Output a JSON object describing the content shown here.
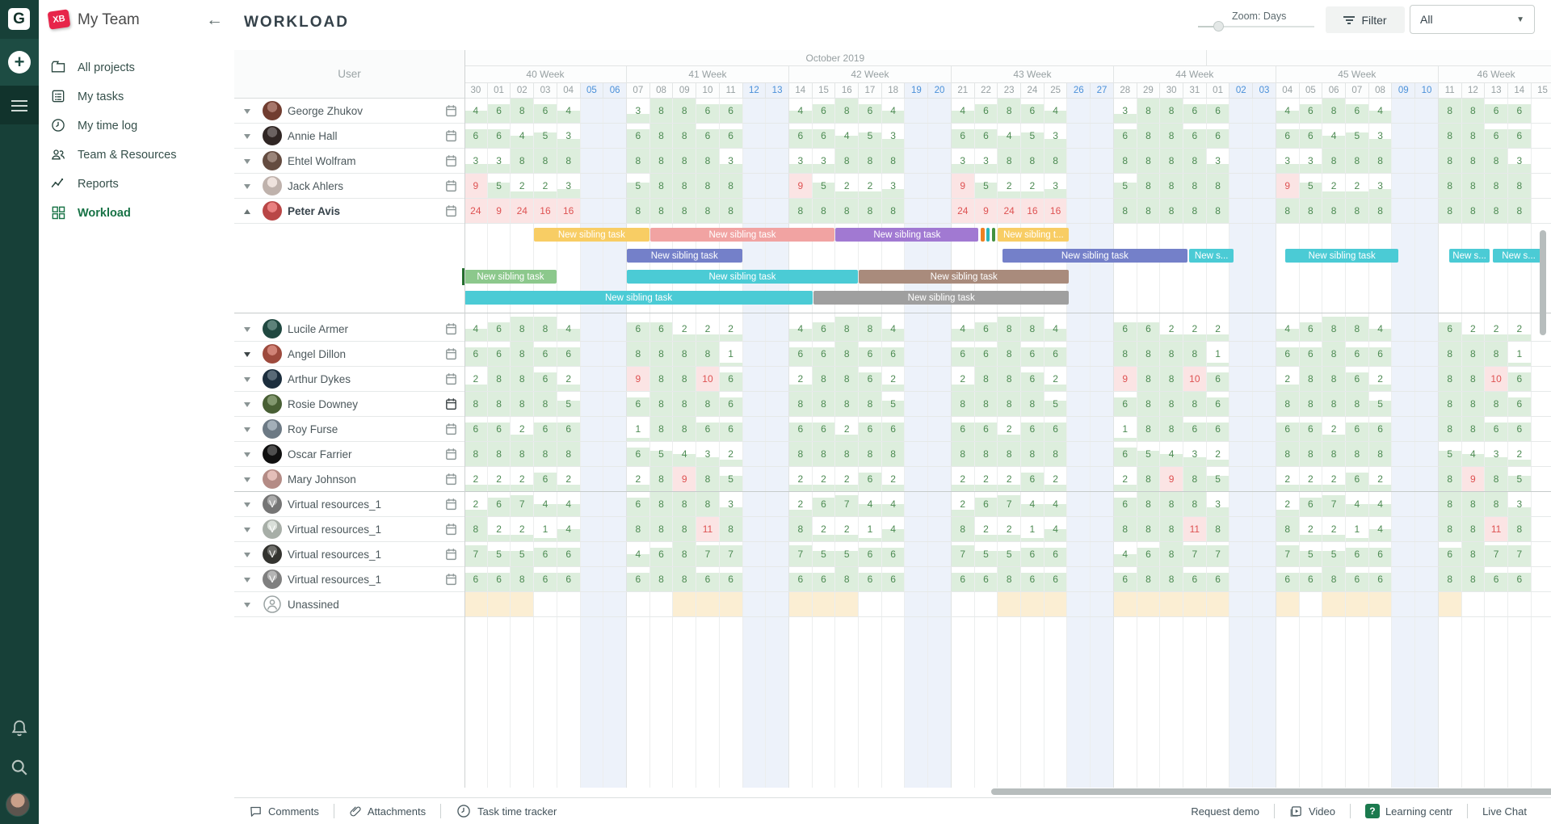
{
  "app": {
    "logo_letter": "G",
    "badge": "XB",
    "team_name": "My Team"
  },
  "sidebar": {
    "items": [
      {
        "label": "All projects",
        "icon": "folder-icon",
        "active": false
      },
      {
        "label": "My tasks",
        "icon": "tasks-icon",
        "active": false
      },
      {
        "label": "My time log",
        "icon": "clock-icon",
        "active": false
      },
      {
        "label": "Team & Resources",
        "icon": "people-icon",
        "active": false
      },
      {
        "label": "Reports",
        "icon": "report-icon",
        "active": false
      },
      {
        "label": "Workload",
        "icon": "workload-icon",
        "active": true
      }
    ]
  },
  "topbar": {
    "title": "WORKLOAD",
    "zoom_label": "Zoom: Days",
    "filter_label": "Filter",
    "assignee_filter_value": "All"
  },
  "grid": {
    "user_column_header": "User",
    "month_label": "October 2019",
    "weeks": [
      {
        "label": "40 Week",
        "days": [
          "30",
          "01",
          "02",
          "03",
          "04",
          "05",
          "06"
        ]
      },
      {
        "label": "41 Week",
        "days": [
          "07",
          "08",
          "09",
          "10",
          "11",
          "12",
          "13"
        ]
      },
      {
        "label": "42 Week",
        "days": [
          "14",
          "15",
          "16",
          "17",
          "18",
          "19",
          "20"
        ]
      },
      {
        "label": "43 Week",
        "days": [
          "21",
          "22",
          "23",
          "24",
          "25",
          "26",
          "27"
        ]
      },
      {
        "label": "44 Week",
        "days": [
          "28",
          "29",
          "30",
          "31",
          "01",
          "02",
          "03"
        ]
      },
      {
        "label": "45 Week",
        "days": [
          "04",
          "05",
          "06",
          "07",
          "08",
          "09",
          "10"
        ]
      },
      {
        "label": "46 Week",
        "days": [
          "11",
          "12",
          "13",
          "14",
          "15"
        ]
      }
    ],
    "weekend_day_indices": [
      5,
      6,
      12,
      13,
      19,
      20,
      26,
      27,
      33,
      34,
      40,
      41
    ],
    "october_end_day_index": 32
  },
  "users": [
    {
      "name": "George Zhukov",
      "avatar_color": "#8a4a3a",
      "values": [
        4,
        6,
        8,
        6,
        4,
        3,
        8,
        8,
        6,
        6,
        4,
        6,
        8,
        6,
        4,
        4,
        6,
        8,
        6,
        4,
        3,
        8,
        8,
        6,
        6,
        4,
        6,
        8,
        6,
        4,
        8,
        8,
        6,
        6
      ]
    },
    {
      "name": "Annie Hall",
      "avatar_color": "#3a2e2c",
      "values": [
        6,
        6,
        4,
        5,
        3,
        6,
        8,
        8,
        6,
        6,
        6,
        6,
        4,
        5,
        3,
        6,
        6,
        4,
        5,
        3,
        6,
        8,
        8,
        6,
        6,
        6,
        6,
        4,
        5,
        3,
        8,
        8,
        6,
        6
      ]
    },
    {
      "name": "Ehtel Wolfram",
      "avatar_color": "#7a5c4e",
      "values": [
        3,
        3,
        8,
        8,
        8,
        8,
        8,
        8,
        8,
        3,
        3,
        3,
        8,
        8,
        8,
        3,
        3,
        8,
        8,
        8,
        8,
        8,
        8,
        8,
        3,
        3,
        3,
        8,
        8,
        8,
        8,
        8,
        8,
        3
      ]
    },
    {
      "name": "Jack Ahlers",
      "avatar_color": "#e9d9d2",
      "values": [
        9,
        5,
        2,
        2,
        3,
        5,
        8,
        8,
        8,
        8,
        9,
        5,
        2,
        2,
        3,
        9,
        5,
        2,
        2,
        3,
        5,
        8,
        8,
        8,
        8,
        9,
        5,
        2,
        2,
        3,
        8,
        8,
        8,
        8
      ]
    },
    {
      "name": "Peter Avis",
      "bold": true,
      "expanded": true,
      "avatar_color": "#e25555",
      "values": [
        24,
        9,
        24,
        16,
        16,
        8,
        8,
        8,
        8,
        8,
        8,
        8,
        8,
        8,
        8,
        24,
        9,
        24,
        16,
        16,
        8,
        8,
        8,
        8,
        8,
        8,
        8,
        8,
        8,
        8,
        8,
        8,
        8,
        8
      ]
    },
    {
      "name": "Lucile Armer",
      "avatar_color": "#27584e",
      "values": [
        4,
        6,
        8,
        8,
        4,
        6,
        6,
        2,
        2,
        2,
        4,
        6,
        8,
        8,
        4,
        4,
        6,
        8,
        8,
        4,
        6,
        6,
        2,
        2,
        2,
        4,
        6,
        8,
        8,
        4,
        6,
        2,
        2,
        2
      ]
    },
    {
      "name": "Angel Dillon",
      "caret_dark": true,
      "avatar_color": "#c05a4a",
      "values": [
        6,
        6,
        8,
        6,
        6,
        8,
        8,
        8,
        8,
        1,
        6,
        6,
        8,
        6,
        6,
        6,
        6,
        8,
        6,
        6,
        8,
        8,
        8,
        8,
        1,
        6,
        6,
        8,
        6,
        6,
        8,
        8,
        8,
        1
      ]
    },
    {
      "name": "Arthur Dykes",
      "avatar_color": "#22384a",
      "values": [
        2,
        8,
        8,
        6,
        2,
        9,
        8,
        8,
        10,
        6,
        2,
        8,
        8,
        6,
        2,
        2,
        8,
        8,
        6,
        2,
        9,
        8,
        8,
        10,
        6,
        2,
        8,
        8,
        6,
        2,
        8,
        8,
        10,
        6
      ]
    },
    {
      "name": "Rosie Downey",
      "calendar_bold": true,
      "avatar_color": "#58743f",
      "values": [
        8,
        8,
        8,
        8,
        5,
        6,
        8,
        8,
        8,
        6,
        8,
        8,
        8,
        8,
        5,
        8,
        8,
        8,
        8,
        5,
        6,
        8,
        8,
        8,
        6,
        8,
        8,
        8,
        8,
        5,
        8,
        8,
        8,
        6
      ]
    },
    {
      "name": "Roy Furse",
      "avatar_color": "#8494a1",
      "values": [
        6,
        6,
        2,
        6,
        6,
        1,
        8,
        8,
        6,
        6,
        6,
        6,
        2,
        6,
        6,
        6,
        6,
        2,
        6,
        6,
        1,
        8,
        8,
        6,
        6,
        6,
        6,
        2,
        6,
        6,
        8,
        8,
        6,
        6
      ]
    },
    {
      "name": "Oscar Farrier",
      "avatar_color": "#141414",
      "values": [
        8,
        8,
        8,
        8,
        8,
        6,
        5,
        4,
        3,
        2,
        8,
        8,
        8,
        8,
        8,
        8,
        8,
        8,
        8,
        8,
        6,
        5,
        4,
        3,
        2,
        8,
        8,
        8,
        8,
        8,
        5,
        4,
        3,
        2
      ]
    },
    {
      "name": "Mary Johnson",
      "divider_after": true,
      "avatar_color": "#dba9a2",
      "values": [
        2,
        2,
        2,
        6,
        2,
        2,
        8,
        9,
        8,
        5,
        2,
        2,
        2,
        6,
        2,
        2,
        2,
        2,
        6,
        2,
        2,
        8,
        9,
        8,
        5,
        2,
        2,
        2,
        6,
        2,
        8,
        9,
        8,
        5
      ]
    },
    {
      "name": "Virtual resources_1",
      "virtual": true,
      "avatar_color": "#8f8f8f",
      "values": [
        2,
        6,
        7,
        4,
        4,
        6,
        8,
        8,
        8,
        3,
        2,
        6,
        7,
        4,
        4,
        2,
        6,
        7,
        4,
        4,
        6,
        8,
        8,
        8,
        3,
        2,
        6,
        7,
        4,
        4,
        8,
        8,
        8,
        3
      ]
    },
    {
      "name": "Virtual resources_1",
      "virtual": true,
      "avatar_color": "#ccd4cc",
      "values": [
        8,
        2,
        2,
        1,
        4,
        8,
        8,
        8,
        11,
        8,
        8,
        2,
        2,
        1,
        4,
        8,
        2,
        2,
        1,
        4,
        8,
        8,
        8,
        11,
        8,
        8,
        2,
        2,
        1,
        4,
        8,
        8,
        11,
        8
      ]
    },
    {
      "name": "Virtual resources_1",
      "virtual": true,
      "avatar_color": "#3f3f3a",
      "values": [
        7,
        5,
        5,
        6,
        6,
        4,
        6,
        8,
        7,
        7,
        7,
        5,
        5,
        6,
        6,
        7,
        5,
        5,
        6,
        6,
        4,
        6,
        8,
        7,
        7,
        7,
        5,
        5,
        6,
        6,
        6,
        8,
        7,
        7
      ]
    },
    {
      "name": "Virtual resources_1",
      "virtual": true,
      "avatar_color": "#9b9b9b",
      "values": [
        6,
        6,
        8,
        6,
        6,
        6,
        8,
        8,
        6,
        6,
        6,
        6,
        8,
        6,
        6,
        6,
        6,
        8,
        6,
        6,
        6,
        8,
        8,
        6,
        6,
        6,
        6,
        8,
        6,
        6,
        8,
        8,
        6,
        6
      ]
    }
  ],
  "unassigned": {
    "name": "Unassined",
    "busy_day_indices": [
      0,
      1,
      2,
      9,
      10,
      11,
      14,
      15,
      16,
      23,
      24,
      25,
      28,
      29,
      30,
      31,
      32,
      35,
      37,
      38,
      39,
      42
    ]
  },
  "task_rows": [
    [
      {
        "label": "New sibling task",
        "color": "#f8cd64",
        "start": 3,
        "end": 8
      },
      {
        "label": "New sibling task",
        "color": "#f1a3a2",
        "start": 8,
        "end": 16
      },
      {
        "label": "New sibling task",
        "color": "#a179d2",
        "start": 16,
        "end": 22.2
      },
      {
        "label": "",
        "color": "#ef8123",
        "start": 22.25,
        "end": 22.45
      },
      {
        "label": "",
        "color": "#2ab5ba",
        "start": 22.5,
        "end": 22.68
      },
      {
        "label": "",
        "color": "#44913f",
        "start": 22.73,
        "end": 22.91
      },
      {
        "label": "New sibling t...",
        "color": "#f8cd64",
        "start": 23,
        "end": 26.1
      }
    ],
    [
      {
        "label": "New sibling task",
        "color": "#7480c9",
        "start": 7,
        "end": 12
      },
      {
        "label": "New sibling task",
        "color": "#7480c9",
        "start": 23.2,
        "end": 31.2
      },
      {
        "label": "New s...",
        "color": "#4bcbd5",
        "start": 31.25,
        "end": 33.2
      },
      {
        "label": "New sibling task",
        "color": "#4bcbd5",
        "start": 35.4,
        "end": 40.3
      },
      {
        "label": "New s...",
        "color": "#4bcbd5",
        "start": 42.45,
        "end": 44.25
      },
      {
        "label": "New s...",
        "color": "#4bcbd5",
        "start": 44.35,
        "end": 46.6
      }
    ],
    [
      {
        "label": "New sibling task",
        "color": "#8cc88c",
        "start": 0,
        "end": 4,
        "left_mark": true
      },
      {
        "label": "New sibling task",
        "color": "#4bcbd5",
        "start": 7,
        "end": 17
      },
      {
        "label": "New sibling task",
        "color": "#a98b7c",
        "start": 17,
        "end": 26.1
      }
    ],
    [
      {
        "label": "New sibling task",
        "color": "#4bcbd5",
        "start": 0,
        "end": 15.05
      },
      {
        "label": "New sibling task",
        "color": "#9f9f9f",
        "start": 15.05,
        "end": 26.1,
        "dotted": true
      }
    ]
  ],
  "colors": {
    "ok_text": "#4c8a52",
    "ok_fill": "#ddeedd",
    "over_text": "#de5252",
    "over_fill": "#fbe4e4",
    "weekend_bg": "#edf2fa",
    "weekend_text": "#4a90d9",
    "unassigned_bg": "#fbeed3",
    "accent_green": "#177245"
  },
  "bottombar": {
    "left": [
      {
        "icon": "comment-icon",
        "label": "Comments"
      },
      {
        "icon": "attachment-icon",
        "label": "Attachments"
      },
      {
        "icon": "clock-icon",
        "label": "Task time tracker"
      }
    ],
    "right": [
      {
        "icon": "",
        "label": "Request demo"
      },
      {
        "icon": "video-icon",
        "label": "Video"
      },
      {
        "icon": "question-icon",
        "label": "Learning centr"
      },
      {
        "icon": "",
        "label": "Live Chat"
      }
    ]
  }
}
